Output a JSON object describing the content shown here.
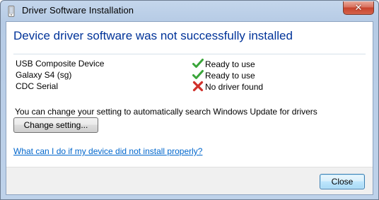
{
  "window": {
    "title": "Driver Software Installation",
    "close_glyph": "✕"
  },
  "main": {
    "headline": "Device driver software was not successfully installed",
    "devices": [
      {
        "name": "USB Composite Device",
        "status": "Ready to use",
        "status_icon": "check-icon"
      },
      {
        "name": "Galaxy S4 (sg)",
        "status": "Ready to use",
        "status_icon": "check-icon"
      },
      {
        "name": "CDC Serial",
        "status": "No driver found",
        "status_icon": "error-x-icon"
      }
    ],
    "info_text": "You can change your setting to automatically search Windows Update for drivers",
    "change_button_label": "Change setting...",
    "help_link_text": "What can I do if my device did not install properly?"
  },
  "footer": {
    "close_button_label": "Close"
  },
  "colors": {
    "headline": "#003399",
    "link": "#0066cc",
    "check": "#3aa53a",
    "error": "#d0302a"
  }
}
